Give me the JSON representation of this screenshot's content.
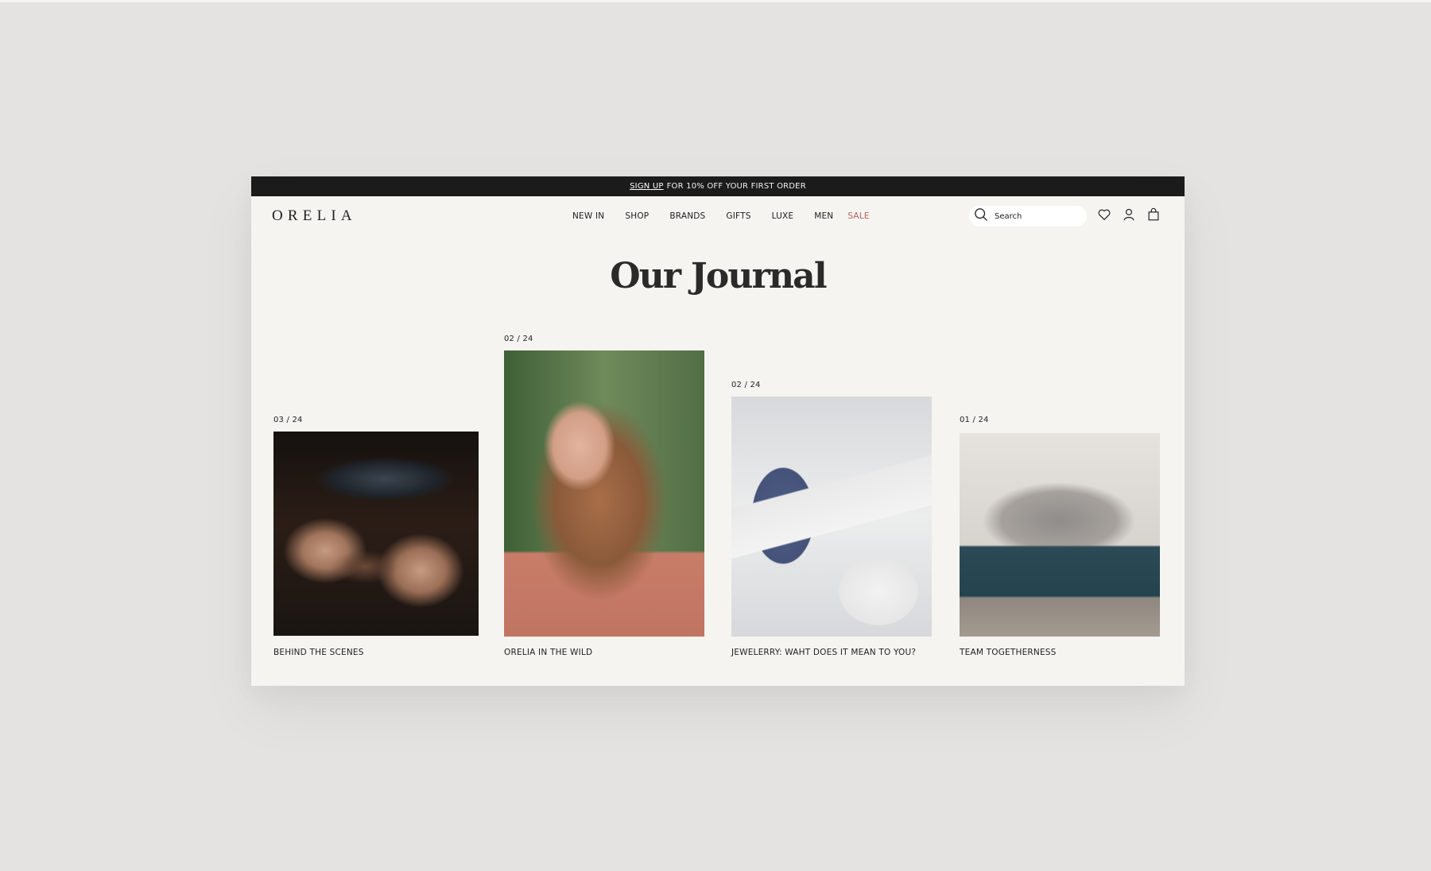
{
  "announcement": {
    "link_label": "SIGN UP",
    "text": "FOR 10% OFF YOUR FIRST ORDER"
  },
  "header": {
    "logo": "ORELIA",
    "menu": [
      {
        "label": "NEW IN"
      },
      {
        "label": "SHOP"
      },
      {
        "label": "BRANDS"
      },
      {
        "label": "GIFTS"
      },
      {
        "label": "LUXE"
      },
      {
        "label": "MEN"
      },
      {
        "label": "SALE"
      }
    ],
    "search": {
      "placeholder": "Search",
      "value": "",
      "icon": "search-icon"
    },
    "icons": [
      "heart-icon",
      "user-icon",
      "shopping-bag-icon"
    ]
  },
  "page": {
    "title": "Our Journal"
  },
  "articles": [
    {
      "date": "03 / 24",
      "title": "BEHIND THE SCENES",
      "image": "jeweller crafting a ring"
    },
    {
      "date": "02 / 24",
      "title": "ORELIA IN THE WILD",
      "image": "woman smiling in pink blazer"
    },
    {
      "date": "02 / 24",
      "title": "JEWELERRY: WAHT DOES IT MEAN TO YOU?",
      "image": "gift box with necklace and birthday card"
    },
    {
      "date": "01 / 24",
      "title": "TEAM TOGETHERNESS",
      "image": "team group photo on sofa"
    }
  ],
  "colors": {
    "announcement_bg": "#1b1b1b",
    "page_bg": "#f5f4f1",
    "sale": "#b0625c",
    "text": "#1e1e1e"
  }
}
